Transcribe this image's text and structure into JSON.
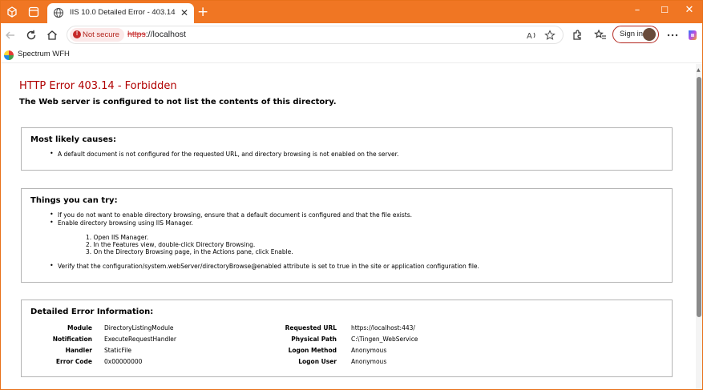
{
  "browser": {
    "tab_title": "IIS 10.0 Detailed Error - 403.14 - Fo",
    "security_label": "Not secure",
    "url_scheme": "https",
    "url_rest": "://localhost",
    "signin_label": "Sign in",
    "favorites": [
      {
        "label": "Spectrum WFH"
      }
    ],
    "colors": {
      "titlebar": "#f07623",
      "not_secure": "#b3261e"
    }
  },
  "page": {
    "title": "HTTP Error 403.14 - Forbidden",
    "subtitle": "The Web server is configured to not list the contents of this directory.",
    "causes": {
      "heading": "Most likely causes:",
      "items": [
        "A default document is not configured for the requested URL, and directory browsing is not enabled on the server."
      ]
    },
    "try": {
      "heading": "Things you can try:",
      "items": [
        "If you do not want to enable directory browsing, ensure that a default document is configured and that the file exists.",
        "Enable directory browsing using IIS Manager.",
        "Verify that the configuration/system.webServer/directoryBrowse@enabled attribute is set to true in the site or application configuration file."
      ],
      "steps": [
        "1. Open IIS Manager.",
        "2. In the Features view, double-click Directory Browsing.",
        "3. On the Directory Browsing page, in the Actions pane, click Enable."
      ]
    },
    "details": {
      "heading": "Detailed Error Information:",
      "left": [
        {
          "label": "Module",
          "value": "DirectoryListingModule"
        },
        {
          "label": "Notification",
          "value": "ExecuteRequestHandler"
        },
        {
          "label": "Handler",
          "value": "StaticFile"
        },
        {
          "label": "Error Code",
          "value": "0x00000000"
        }
      ],
      "right": [
        {
          "label": "Requested URL",
          "value": "https://localhost:443/"
        },
        {
          "label": "Physical Path",
          "value": "C:\\Tingen_WebService"
        },
        {
          "label": "Logon Method",
          "value": "Anonymous"
        },
        {
          "label": "Logon User",
          "value": "Anonymous"
        }
      ]
    }
  }
}
